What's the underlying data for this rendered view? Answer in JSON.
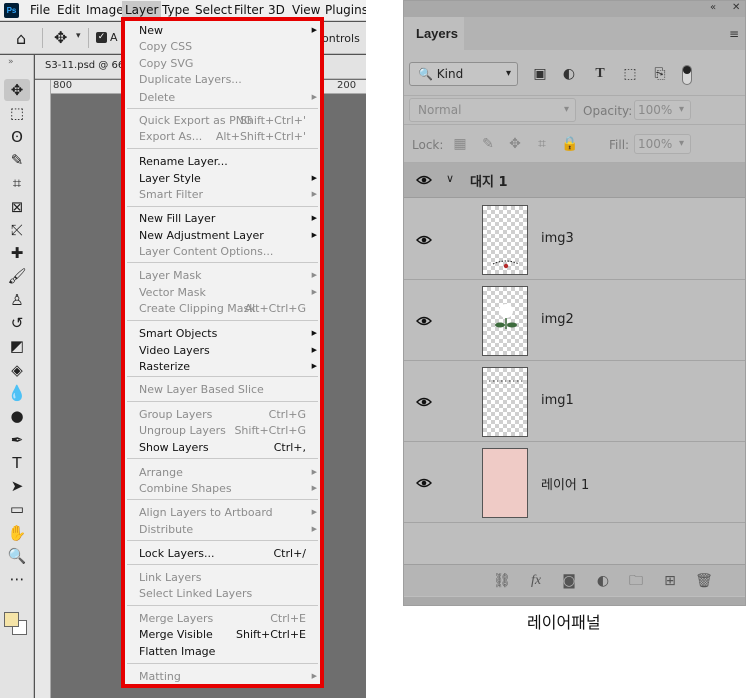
{
  "app": {
    "logo": "Ps",
    "menubar": [
      "File",
      "Edit",
      "Image",
      "Layer",
      "Type",
      "Select",
      "Filter",
      "3D",
      "View",
      "Plugins"
    ],
    "active_menu": "Layer",
    "options": {
      "auto_select_label": "A",
      "controls_label": "ontrols"
    },
    "doc_tab": "S3-11.psd @ 66.",
    "ruler_ticks": [
      "800",
      "200"
    ],
    "swatches": {
      "foreground": "#f5e4a8",
      "background": "#ffffff"
    },
    "tools": [
      "move-icon",
      "marquee-icon",
      "lasso-icon",
      "quick-select-icon",
      "crop-icon",
      "frame-icon",
      "eyedropper-icon",
      "healing-icon",
      "brush-icon",
      "stamp-icon",
      "history-brush-icon",
      "eraser-icon",
      "bucket-icon",
      "blur-icon",
      "dodge-icon",
      "pen-icon",
      "type-icon",
      "path-select-icon",
      "rectangle-icon",
      "hand-icon",
      "zoom-icon",
      "more-icon"
    ]
  },
  "layer_menu": {
    "items": [
      {
        "label": "New",
        "shortcut": "",
        "submenu": true,
        "disabled": false
      },
      {
        "label": "Copy CSS",
        "shortcut": "",
        "submenu": false,
        "disabled": true
      },
      {
        "label": "Copy SVG",
        "shortcut": "",
        "submenu": false,
        "disabled": true
      },
      {
        "label": "Duplicate Layers...",
        "shortcut": "",
        "submenu": false,
        "disabled": true
      },
      {
        "label": "Delete",
        "shortcut": "",
        "submenu": true,
        "disabled": true
      },
      {
        "label": "Quick Export as PNG",
        "shortcut": "Shift+Ctrl+'",
        "submenu": false,
        "disabled": true
      },
      {
        "label": "Export As...",
        "shortcut": "Alt+Shift+Ctrl+'",
        "submenu": false,
        "disabled": true
      },
      {
        "label": "Rename Layer...",
        "shortcut": "",
        "submenu": false,
        "disabled": false
      },
      {
        "label": "Layer Style",
        "shortcut": "",
        "submenu": true,
        "disabled": false
      },
      {
        "label": "Smart Filter",
        "shortcut": "",
        "submenu": true,
        "disabled": true
      },
      {
        "label": "New Fill Layer",
        "shortcut": "",
        "submenu": true,
        "disabled": false
      },
      {
        "label": "New Adjustment Layer",
        "shortcut": "",
        "submenu": true,
        "disabled": false
      },
      {
        "label": "Layer Content Options...",
        "shortcut": "",
        "submenu": false,
        "disabled": true
      },
      {
        "label": "Layer Mask",
        "shortcut": "",
        "submenu": true,
        "disabled": true
      },
      {
        "label": "Vector Mask",
        "shortcut": "",
        "submenu": true,
        "disabled": true
      },
      {
        "label": "Create Clipping Mask",
        "shortcut": "Alt+Ctrl+G",
        "submenu": false,
        "disabled": true
      },
      {
        "label": "Smart Objects",
        "shortcut": "",
        "submenu": true,
        "disabled": false
      },
      {
        "label": "Video Layers",
        "shortcut": "",
        "submenu": true,
        "disabled": false
      },
      {
        "label": "Rasterize",
        "shortcut": "",
        "submenu": true,
        "disabled": false
      },
      {
        "label": "New Layer Based Slice",
        "shortcut": "",
        "submenu": false,
        "disabled": true
      },
      {
        "label": "Group Layers",
        "shortcut": "Ctrl+G",
        "submenu": false,
        "disabled": true
      },
      {
        "label": "Ungroup Layers",
        "shortcut": "Shift+Ctrl+G",
        "submenu": false,
        "disabled": true
      },
      {
        "label": "Show Layers",
        "shortcut": "Ctrl+,",
        "submenu": false,
        "disabled": false
      },
      {
        "label": "Arrange",
        "shortcut": "",
        "submenu": true,
        "disabled": true
      },
      {
        "label": "Combine Shapes",
        "shortcut": "",
        "submenu": true,
        "disabled": true
      },
      {
        "label": "Align Layers to Artboard",
        "shortcut": "",
        "submenu": true,
        "disabled": true
      },
      {
        "label": "Distribute",
        "shortcut": "",
        "submenu": true,
        "disabled": true
      },
      {
        "label": "Lock Layers...",
        "shortcut": "Ctrl+/",
        "submenu": false,
        "disabled": false
      },
      {
        "label": "Link Layers",
        "shortcut": "",
        "submenu": false,
        "disabled": true
      },
      {
        "label": "Select Linked Layers",
        "shortcut": "",
        "submenu": false,
        "disabled": true
      },
      {
        "label": "Merge Layers",
        "shortcut": "Ctrl+E",
        "submenu": false,
        "disabled": true
      },
      {
        "label": "Merge Visible",
        "shortcut": "Shift+Ctrl+E",
        "submenu": false,
        "disabled": false
      },
      {
        "label": "Flatten Image",
        "shortcut": "",
        "submenu": false,
        "disabled": false
      },
      {
        "label": "Matting",
        "shortcut": "",
        "submenu": true,
        "disabled": true
      }
    ]
  },
  "layers_panel": {
    "tab": "Layers",
    "filter_kind": "Kind",
    "blend_mode": "Normal",
    "opacity_label": "Opacity:",
    "opacity_value": "100%",
    "lock_label": "Lock:",
    "fill_label": "Fill:",
    "fill_value": "100%",
    "group_name": "대지 1",
    "layers": [
      {
        "name": "img3",
        "type": "transparent"
      },
      {
        "name": "img2",
        "type": "transparent"
      },
      {
        "name": "img1",
        "type": "transparent"
      },
      {
        "name": "레이어 1",
        "type": "solid",
        "color": "#efcbc6"
      }
    ],
    "bottom_icons": [
      "link-icon",
      "fx-icon",
      "mask-icon",
      "adjustment-icon",
      "folder-icon",
      "new-layer-icon",
      "trash-icon"
    ]
  },
  "caption": "레이어패널"
}
